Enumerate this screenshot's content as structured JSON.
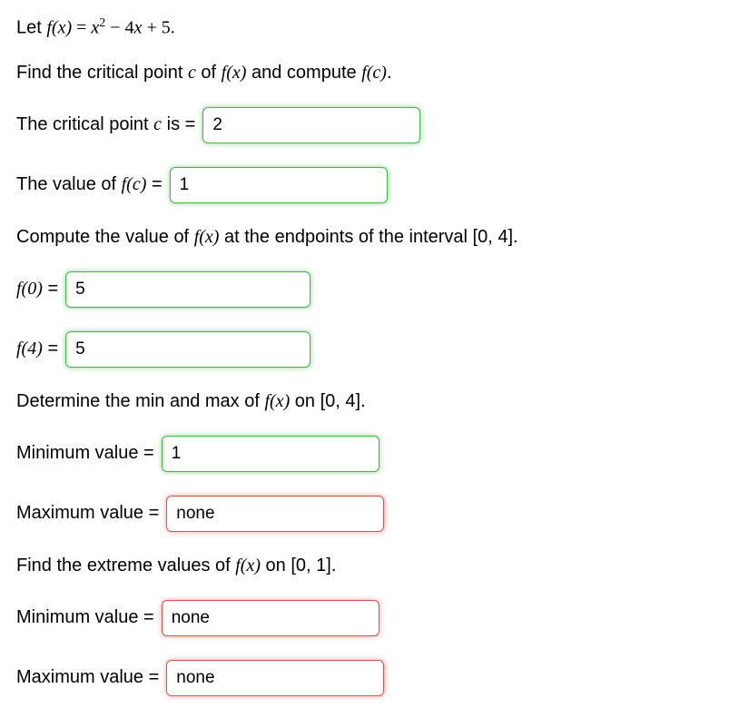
{
  "q1": {
    "def_prefix": "Let ",
    "def_fx": "f(x)",
    "def_eq": " = ",
    "def_x": "x",
    "def_sup": "2",
    "def_minus": " − 4",
    "def_x2": "x",
    "def_plus": " + 5."
  },
  "p1": {
    "t1": "Find the critical point ",
    "c": "c",
    "t2": " of ",
    "fx": "f(x)",
    "t3": " and compute ",
    "fc": "f(c)",
    "t4": "."
  },
  "crit": {
    "label1": "The critical point ",
    "c": "c",
    "label2": " is = ",
    "value": "2"
  },
  "fc": {
    "label1": "The value of ",
    "fc": "f(c)",
    "label2": " = ",
    "value": "1"
  },
  "p2": {
    "t1": "Compute the value of ",
    "fx": "f(x)",
    "t2": " at the endpoints of the interval ",
    "interval": "[0, 4]",
    "t3": "."
  },
  "f0": {
    "label": "f(0)",
    "eq": " = ",
    "value": "5"
  },
  "f4": {
    "label": "f(4)",
    "eq": " = ",
    "value": "5"
  },
  "p3": {
    "t1": "Determine the min and max of ",
    "fx": "f(x)",
    "t2": " on ",
    "interval": "[0, 4]",
    "t3": "."
  },
  "min1": {
    "label": "Minimum value = ",
    "value": "1"
  },
  "max1": {
    "label": "Maximum value = ",
    "value": "none"
  },
  "p4": {
    "t1": "Find the extreme values of ",
    "fx": "f(x)",
    "t2": " on ",
    "interval": "[0, 1]",
    "t3": "."
  },
  "min2": {
    "label": "Minimum value = ",
    "value": "none"
  },
  "max2": {
    "label": "Maximum value = ",
    "value": "none"
  }
}
